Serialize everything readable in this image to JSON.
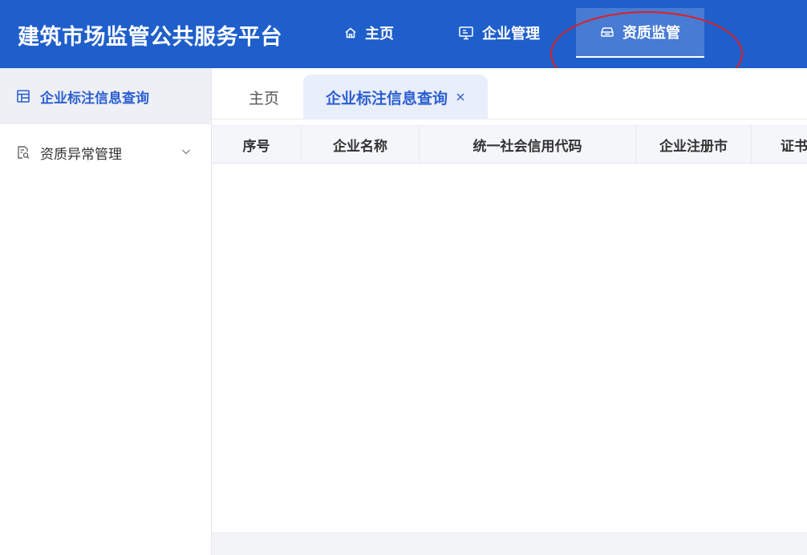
{
  "header": {
    "title": "建筑市场监管公共服务平台",
    "nav": [
      {
        "label": "主页",
        "icon": "home-icon"
      },
      {
        "label": "企业管理",
        "icon": "monitor-icon"
      },
      {
        "label": "资质监管",
        "icon": "inbox-icon",
        "active": true
      }
    ]
  },
  "sidebar": {
    "items": [
      {
        "label": "企业标注信息查询",
        "icon": "table-icon",
        "active": true
      },
      {
        "label": "资质异常管理",
        "icon": "document-search-icon",
        "expandable": true
      }
    ]
  },
  "tabs": [
    {
      "label": "主页"
    },
    {
      "label": "企业标注信息查询",
      "active": true,
      "closable": true
    }
  ],
  "table": {
    "columns": [
      "序号",
      "企业名称",
      "统一社会信用代码",
      "企业注册市",
      "证书"
    ]
  },
  "colors": {
    "header_bg": "#1f5fcb",
    "accent": "#2b5fd0",
    "annotation": "#e02020"
  }
}
